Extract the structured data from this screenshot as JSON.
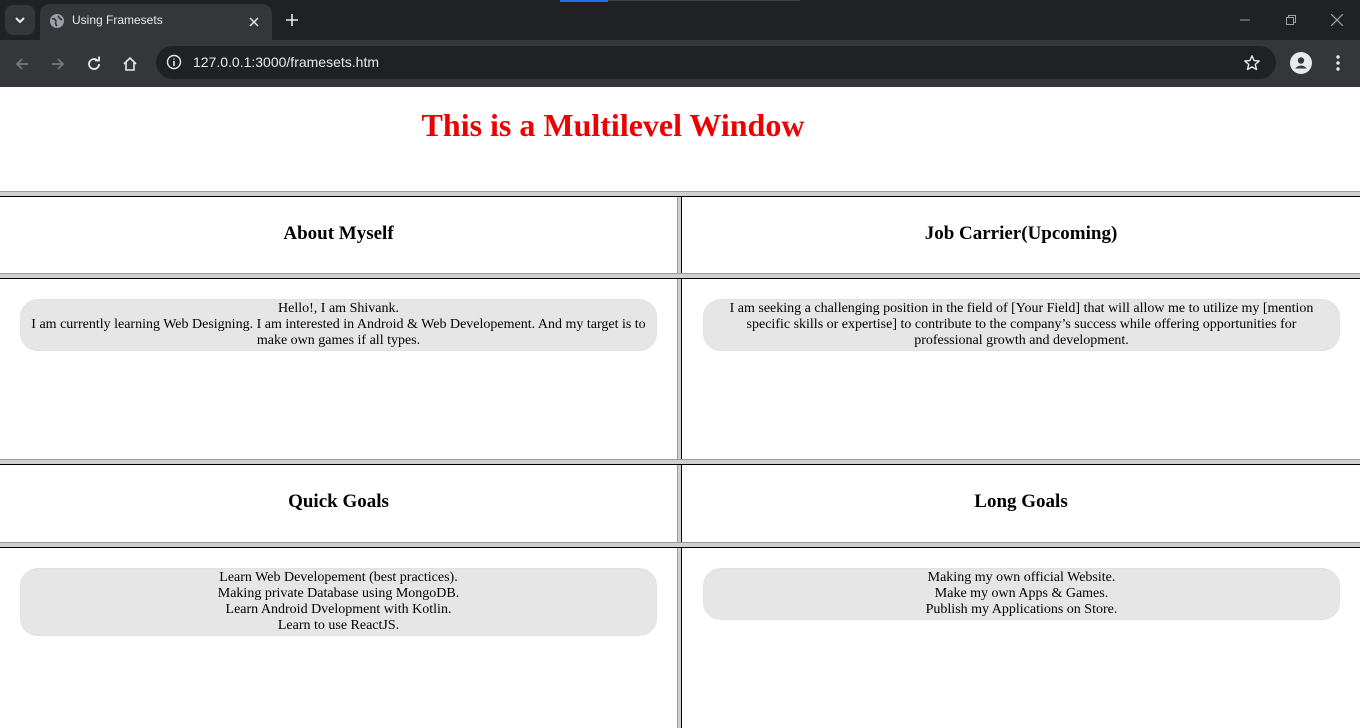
{
  "browser": {
    "tab_title": "Using Framesets",
    "url_host": "127.0.0.1:3000",
    "url_path": "/framesets.htm"
  },
  "page": {
    "title": "This is a Multilevel Window",
    "title_color": "#ee0000",
    "frames": {
      "about": {
        "heading": "About Myself",
        "lines": [
          "Hello!, I am Shivank.",
          "I am currently learning Web Designing. I am interested in Android & Web Developement. And my target is to make own games if all types."
        ]
      },
      "job": {
        "heading": "Job Carrier(Upcoming)",
        "lines": [
          "I am seeking a challenging position in the field of [Your Field] that will allow me to utilize my [mention specific skills or expertise] to contribute to the company’s success while offering opportunities for professional growth and development."
        ]
      },
      "quick": {
        "heading": "Quick Goals",
        "lines": [
          "Learn Web Developement (best practices).",
          "Making private Database using MongoDB.",
          "Learn Android Dvelopment with Kotlin.",
          "Learn to use ReactJS."
        ]
      },
      "long": {
        "heading": "Long Goals",
        "lines": [
          "Making my own official Website.",
          "Make my own Apps & Games.",
          "Publish my Applications on Store."
        ]
      }
    }
  }
}
